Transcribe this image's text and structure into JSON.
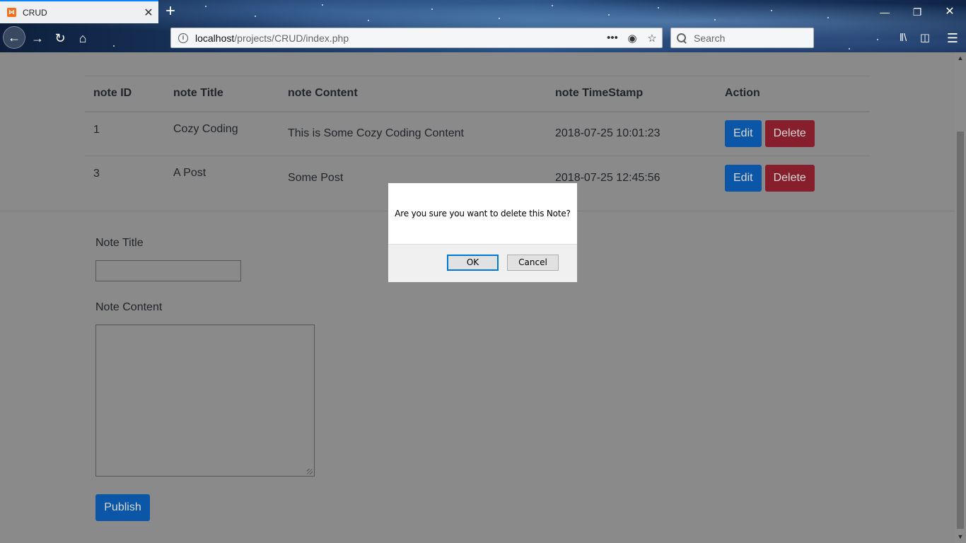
{
  "browser": {
    "tab_title": "CRUD",
    "tab_favicon": "xampp-icon",
    "url_host": "localhost",
    "url_path": "/projects/CRUD/index.php",
    "search_placeholder": "Search"
  },
  "table": {
    "headers": [
      "note ID",
      "note Title",
      "note Content",
      "note TimeStamp",
      "Action"
    ],
    "rows": [
      {
        "id": "1",
        "title": "Cozy Coding",
        "content": "This is Some Cozy Coding Content",
        "timestamp": "2018-07-25 10:01:23"
      },
      {
        "id": "3",
        "title": "A Post",
        "content": "Some Post",
        "timestamp": "2018-07-25 12:45:56"
      }
    ],
    "edit_label": "Edit",
    "delete_label": "Delete"
  },
  "form": {
    "title_label": "Note Title",
    "content_label": "Note Content",
    "title_value": "",
    "content_value": "",
    "publish_label": "Publish"
  },
  "dialog": {
    "message": "Are you sure you want to delete this Note?",
    "ok_label": "OK",
    "cancel_label": "Cancel"
  },
  "colors": {
    "edit_button": "#0b56a6",
    "delete_button": "#861f2b",
    "overlay_page": "#8a8a8a",
    "dialog_focus": "#0078d7"
  }
}
